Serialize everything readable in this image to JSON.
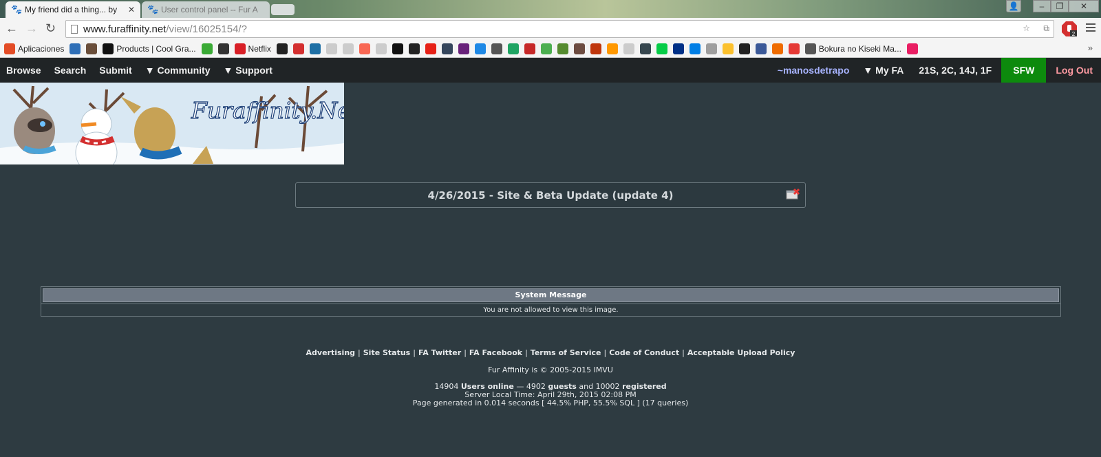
{
  "browser": {
    "tabs": [
      {
        "title": "My friend did a thing... by",
        "active": true
      },
      {
        "title": "User control panel -- Fur A",
        "active": false
      }
    ],
    "url_host": "www.furaffinity.net",
    "url_path": "/view/16025154/?",
    "extension_badge": "2",
    "bookmarks": [
      {
        "label": "Aplicaciones",
        "icon": "apps-grid-icon",
        "color": "#e34c26"
      },
      {
        "label": "",
        "icon": "blue-square-icon",
        "color": "#2f6fb7"
      },
      {
        "label": "",
        "icon": "instagram-icon",
        "color": "#6a4e3a"
      },
      {
        "label": "Products | Cool Gra...",
        "icon": "coolgra-icon",
        "color": "#111111"
      },
      {
        "label": "",
        "icon": "green-circle-icon",
        "color": "#3aaa35"
      },
      {
        "label": "",
        "icon": "cube-icon",
        "color": "#333333"
      },
      {
        "label": "Netflix",
        "icon": "netflix-icon",
        "color": "#d81f26"
      },
      {
        "label": "",
        "icon": "paw-icon",
        "color": "#222222"
      },
      {
        "label": "",
        "icon": "red-feather-icon",
        "color": "#d32f2f"
      },
      {
        "label": "",
        "icon": "blue-gear-icon",
        "color": "#1d6fa5"
      },
      {
        "label": "",
        "icon": "page-icon",
        "color": "#cccccc"
      },
      {
        "label": "",
        "icon": "page-icon",
        "color": "#cccccc"
      },
      {
        "label": "",
        "icon": "patreon-icon",
        "color": "#f96854"
      },
      {
        "label": "",
        "icon": "page-icon",
        "color": "#cccccc"
      },
      {
        "label": "",
        "icon": "te-icon",
        "color": "#111111"
      },
      {
        "label": "",
        "icon": "hd-icon",
        "color": "#222222"
      },
      {
        "label": "",
        "icon": "youtube-icon",
        "color": "#e62117"
      },
      {
        "label": "",
        "icon": "tumblr-icon",
        "color": "#35465c"
      },
      {
        "label": "",
        "icon": "vs-icon",
        "color": "#68217a"
      },
      {
        "label": "",
        "icon": "blue-c-icon",
        "color": "#1e88e5"
      },
      {
        "label": "",
        "icon": "skull-icon",
        "color": "#555555"
      },
      {
        "label": "",
        "icon": "drive-icon",
        "color": "#1fa463"
      },
      {
        "label": "",
        "icon": "red-f-icon",
        "color": "#c62828"
      },
      {
        "label": "",
        "icon": "dollar-icon",
        "color": "#4caf50"
      },
      {
        "label": "",
        "icon": "tree-icon",
        "color": "#558b2f"
      },
      {
        "label": "",
        "icon": "brown-icon",
        "color": "#6d4c41"
      },
      {
        "label": "",
        "icon": "nr-icon",
        "color": "#bf360c"
      },
      {
        "label": "",
        "icon": "sun-icon",
        "color": "#ff9800"
      },
      {
        "label": "",
        "icon": "page-icon",
        "color": "#cccccc"
      },
      {
        "label": "",
        "icon": "shield-icon",
        "color": "#37474f"
      },
      {
        "label": "",
        "icon": "deviantart-icon",
        "color": "#05cc47"
      },
      {
        "label": "",
        "icon": "paypal-icon",
        "color": "#003087"
      },
      {
        "label": "",
        "icon": "dropbox-icon",
        "color": "#007ee5"
      },
      {
        "label": "",
        "icon": "grey-icon",
        "color": "#9e9e9e"
      },
      {
        "label": "",
        "icon": "yellow-icon",
        "color": "#fbc02d"
      },
      {
        "label": "",
        "icon": "amazon-icon",
        "color": "#222222"
      },
      {
        "label": "",
        "icon": "facebook-icon",
        "color": "#3b5998"
      },
      {
        "label": "",
        "icon": "color-squares-icon",
        "color": "#ef6c00"
      },
      {
        "label": "",
        "icon": "red-ring-icon",
        "color": "#e53935"
      },
      {
        "label": "Bokura no Kiseki Ma...",
        "icon": "y-icon",
        "color": "#555555"
      },
      {
        "label": "",
        "icon": "character-icon",
        "color": "#e91e63"
      }
    ],
    "bookmarks_more": "»"
  },
  "fa": {
    "nav": [
      {
        "label": "Browse"
      },
      {
        "label": "Search"
      },
      {
        "label": "Submit"
      },
      {
        "label": "▼ Community"
      },
      {
        "label": "▼ Support"
      }
    ],
    "username": "~manosdetrapo",
    "myfa": "▼ My FA",
    "counts": "21S, 2C, 14J, 1F",
    "sfw": "SFW",
    "logout": "Log Out",
    "banner_text": "Furaffinity.Net",
    "notice": "4/26/2015 - Site & Beta Update (update 4)",
    "system_title": "System Message",
    "system_message": "You are not allowed to view this image.",
    "footer_links": [
      "Advertising",
      "Site Status",
      "FA Twitter",
      "FA Facebook",
      "Terms of Service",
      "Code of Conduct",
      "Acceptable Upload Policy"
    ],
    "copyright": "Fur Affinity is © 2005-2015 IMVU",
    "users_total": "14904",
    "users_online_label": "Users online",
    "dash": "—",
    "guests_count": "4902",
    "guests_label": "guests",
    "and": "and",
    "registered_count": "10002",
    "registered_label": "registered",
    "server_time": "Server Local Time: April 29th, 2015 02:08 PM",
    "page_generated": "Page generated in 0.014 seconds [ 44.5% PHP, 55.5% SQL ] (17 queries)"
  },
  "colors": {
    "page_bg": "#2e3b41",
    "nav_bg": "#202426",
    "sfw_green": "#0d8a0d",
    "username": "#a7b3ff",
    "logout": "#ff9aa2"
  }
}
